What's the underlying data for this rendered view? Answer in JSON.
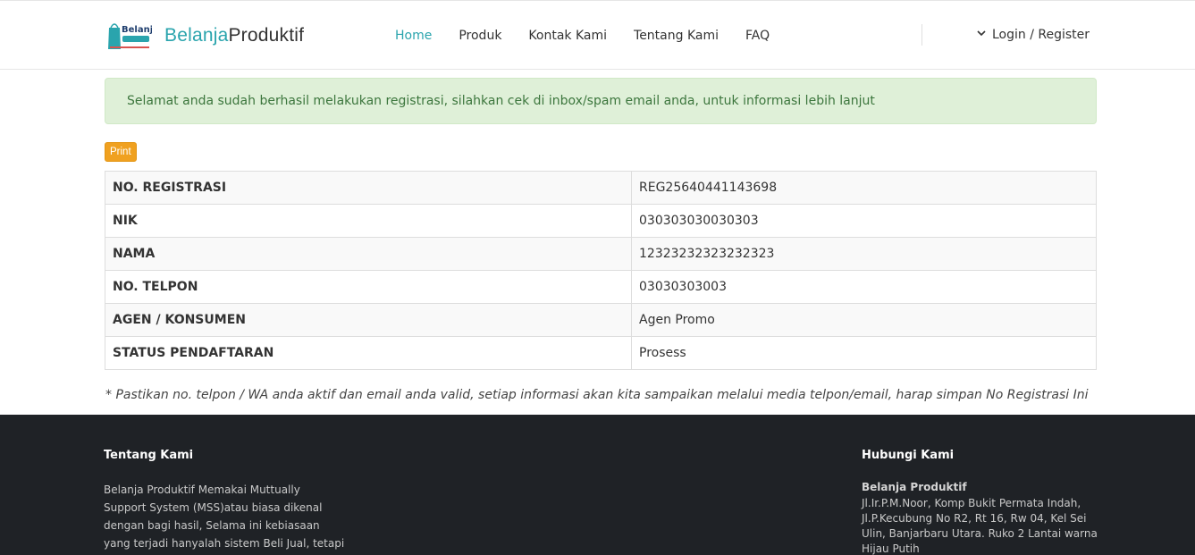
{
  "header": {
    "brand_part1": "Belanja",
    "brand_part2": "Produktif",
    "logo_text": "Belanja",
    "nav": [
      {
        "label": "Home",
        "active": true
      },
      {
        "label": "Produk"
      },
      {
        "label": "Kontak Kami"
      },
      {
        "label": "Tentang Kami"
      },
      {
        "label": "FAQ"
      }
    ],
    "login_label": "Login / Register"
  },
  "alert": {
    "message": "Selamat anda sudah berhasil melakukan registrasi, silahkan cek di inbox/spam email anda, untuk informasi lebih lanjut"
  },
  "print_label": "Print",
  "registration": {
    "rows": [
      {
        "label": "NO. REGISTRASI",
        "value": "REG25640441143698"
      },
      {
        "label": "NIK",
        "value": "030303030030303"
      },
      {
        "label": "NAMA",
        "value": "12323232323232323"
      },
      {
        "label": "NO. TELPON",
        "value": "03030303003"
      },
      {
        "label": "AGEN / KONSUMEN",
        "value": "Agen Promo"
      },
      {
        "label": "STATUS PENDAFTARAN",
        "value": "Prosess"
      }
    ]
  },
  "note": "* Pastikan no. telpon / WA anda aktif dan email anda valid, setiap informasi akan kita sampaikan melalui media telpon/email, harap simpan No Registrasi Ini",
  "footer": {
    "about_title": "Tentang Kami",
    "about_text": "Belanja Produktif Memakai Muttually Support System (MSS)atau biasa dikenal dengan bagi hasil, Selama ini kebiasaan yang terjadi hanyalah sistem Beli Jual, tetapi Program",
    "contact_title": "Hubungi Kami",
    "company": "Belanja Produktif",
    "address": "Jl.Ir.P.M.Noor, Komp Bukit Permata Indah, Jl.P.Kecubung No R2, Rt 16, Rw 04, Kel Sei Ulin, Banjarbaru Utara. Ruko 2 Lantai warna Hijau Putih"
  },
  "colors": {
    "accent": "#2aa4ad",
    "alert_bg": "#dff0d8",
    "print_btn": "#f0a120",
    "footer_bg": "#1f2226"
  }
}
